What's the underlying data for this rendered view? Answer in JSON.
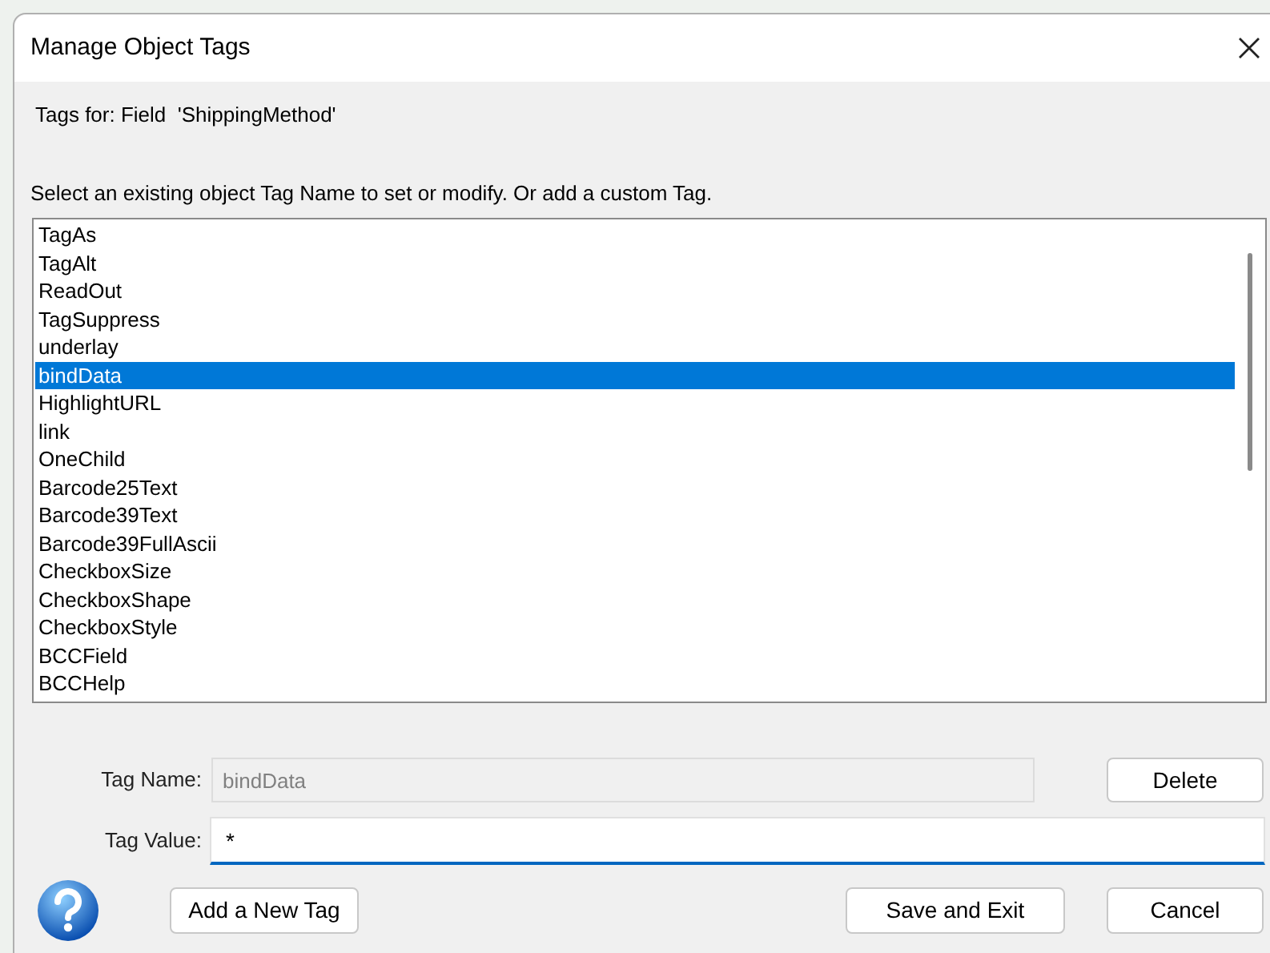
{
  "window": {
    "title": "Manage Object Tags"
  },
  "tags_for": "Tags for: Field  'ShippingMethod'",
  "instruction": "Select an existing object Tag Name to set or modify. Or add a custom Tag.",
  "tag_list": [
    {
      "label": "TagAs",
      "selected": false
    },
    {
      "label": "TagAlt",
      "selected": false
    },
    {
      "label": "ReadOut",
      "selected": false
    },
    {
      "label": "TagSuppress",
      "selected": false
    },
    {
      "label": "underlay",
      "selected": false
    },
    {
      "label": "bindData",
      "selected": true
    },
    {
      "label": "HighlightURL",
      "selected": false
    },
    {
      "label": "link",
      "selected": false
    },
    {
      "label": "OneChild",
      "selected": false
    },
    {
      "label": "Barcode25Text",
      "selected": false
    },
    {
      "label": "Barcode39Text",
      "selected": false
    },
    {
      "label": "Barcode39FullAscii",
      "selected": false
    },
    {
      "label": "CheckboxSize",
      "selected": false
    },
    {
      "label": "CheckboxShape",
      "selected": false
    },
    {
      "label": "CheckboxStyle",
      "selected": false
    },
    {
      "label": "BCCField",
      "selected": false
    },
    {
      "label": "BCCHelp",
      "selected": false
    }
  ],
  "tag_name": {
    "label": "Tag Name:",
    "value": "bindData",
    "disabled": true
  },
  "delete_button": "Delete",
  "tag_value": {
    "label": "Tag Value:",
    "value": "*"
  },
  "add_button": "Add a New Tag",
  "save_button": "Save and Exit",
  "cancel_button": "Cancel"
}
